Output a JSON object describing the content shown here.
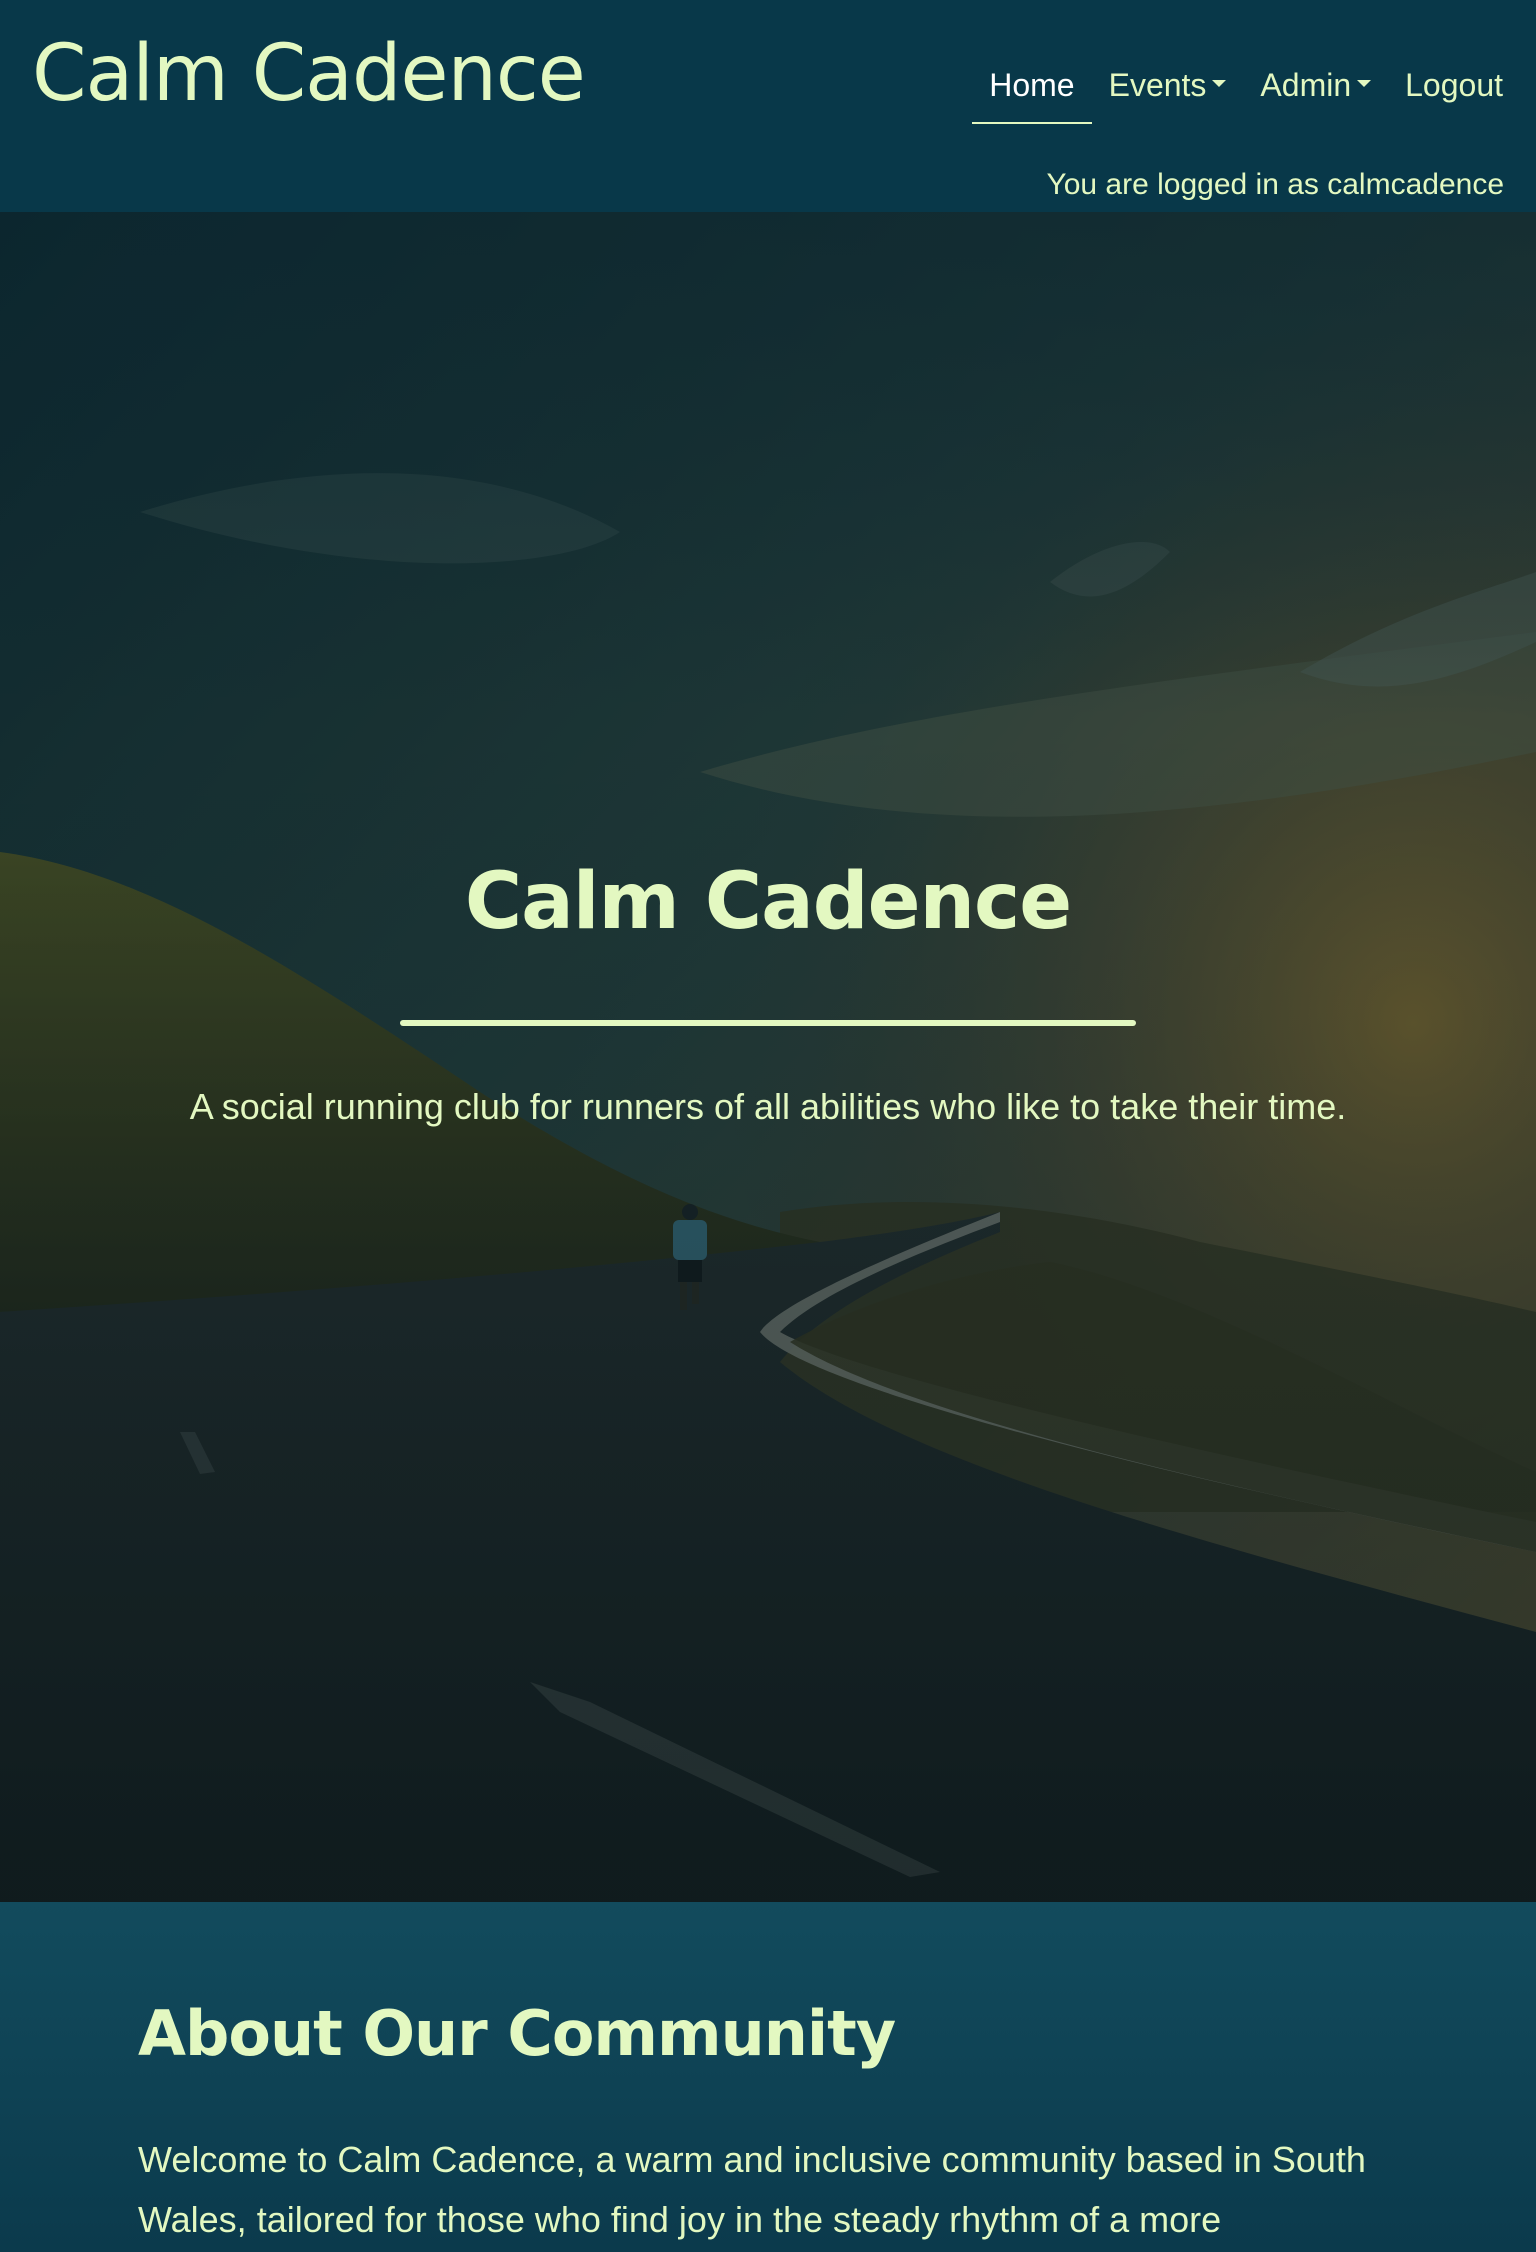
{
  "navbar": {
    "brand": "Calm Cadence",
    "links": [
      {
        "label": "Home",
        "active": true,
        "dropdown": false
      },
      {
        "label": "Events",
        "active": false,
        "dropdown": true
      },
      {
        "label": "Admin",
        "active": false,
        "dropdown": true
      },
      {
        "label": "Logout",
        "active": false,
        "dropdown": false
      }
    ],
    "logged_in_text": "You are logged in as calmcadence"
  },
  "hero": {
    "title": "Calm Cadence",
    "subtitle": "A social running club for runners of all abilities who like to take their time."
  },
  "about": {
    "title": "About Our Community",
    "text": "Welcome to Calm Cadence, a warm and inclusive community based in South Wales, tailored for those who find joy in the steady rhythm of a more"
  },
  "colors": {
    "navbar_bg": "#083849",
    "accent_text": "#e3f8c1",
    "section_bg": "#0b3a4c"
  }
}
